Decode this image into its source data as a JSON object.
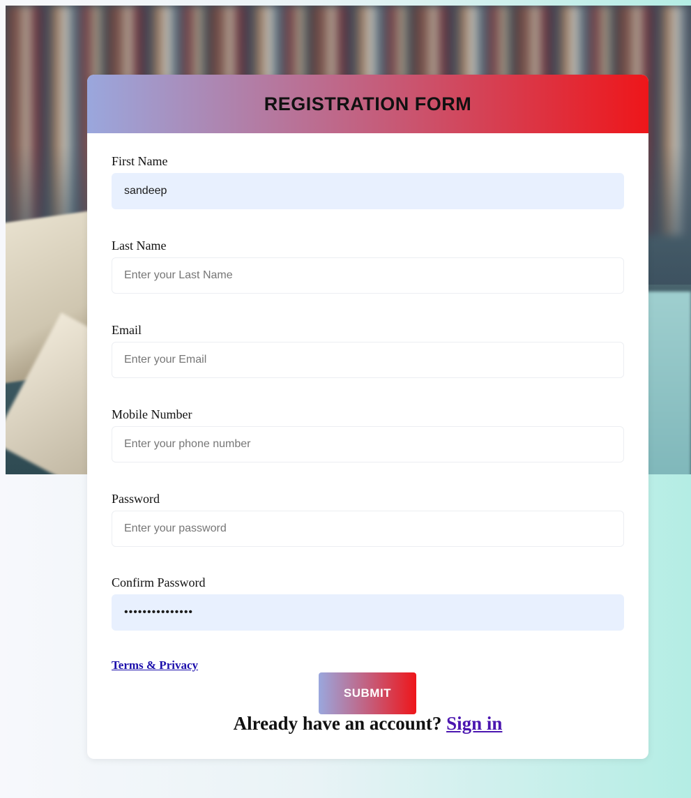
{
  "form": {
    "title": "REGISTRATION FORM",
    "fields": [
      {
        "label": "First Name",
        "value": "sandeep",
        "placeholder": ""
      },
      {
        "label": "Last Name",
        "value": "",
        "placeholder": "Enter your Last Name"
      },
      {
        "label": "Email",
        "value": "",
        "placeholder": "Enter your Email"
      },
      {
        "label": "Mobile Number",
        "value": "",
        "placeholder": "Enter your phone number"
      },
      {
        "label": "Password",
        "value": "",
        "placeholder": "Enter your password"
      },
      {
        "label": "Confirm Password",
        "value": "•••••••••••••••",
        "placeholder": ""
      }
    ],
    "terms_link": "Terms & Privacy",
    "submit_label": "SUBMIT",
    "signin_prompt": "Already have an account?",
    "signin_link": "Sign in"
  },
  "colors": {
    "header_gradient_start": "#9aa7dd",
    "header_gradient_end": "#ee161a",
    "autofill_bg": "#e8f0fe",
    "link_color": "#1a0dab"
  }
}
